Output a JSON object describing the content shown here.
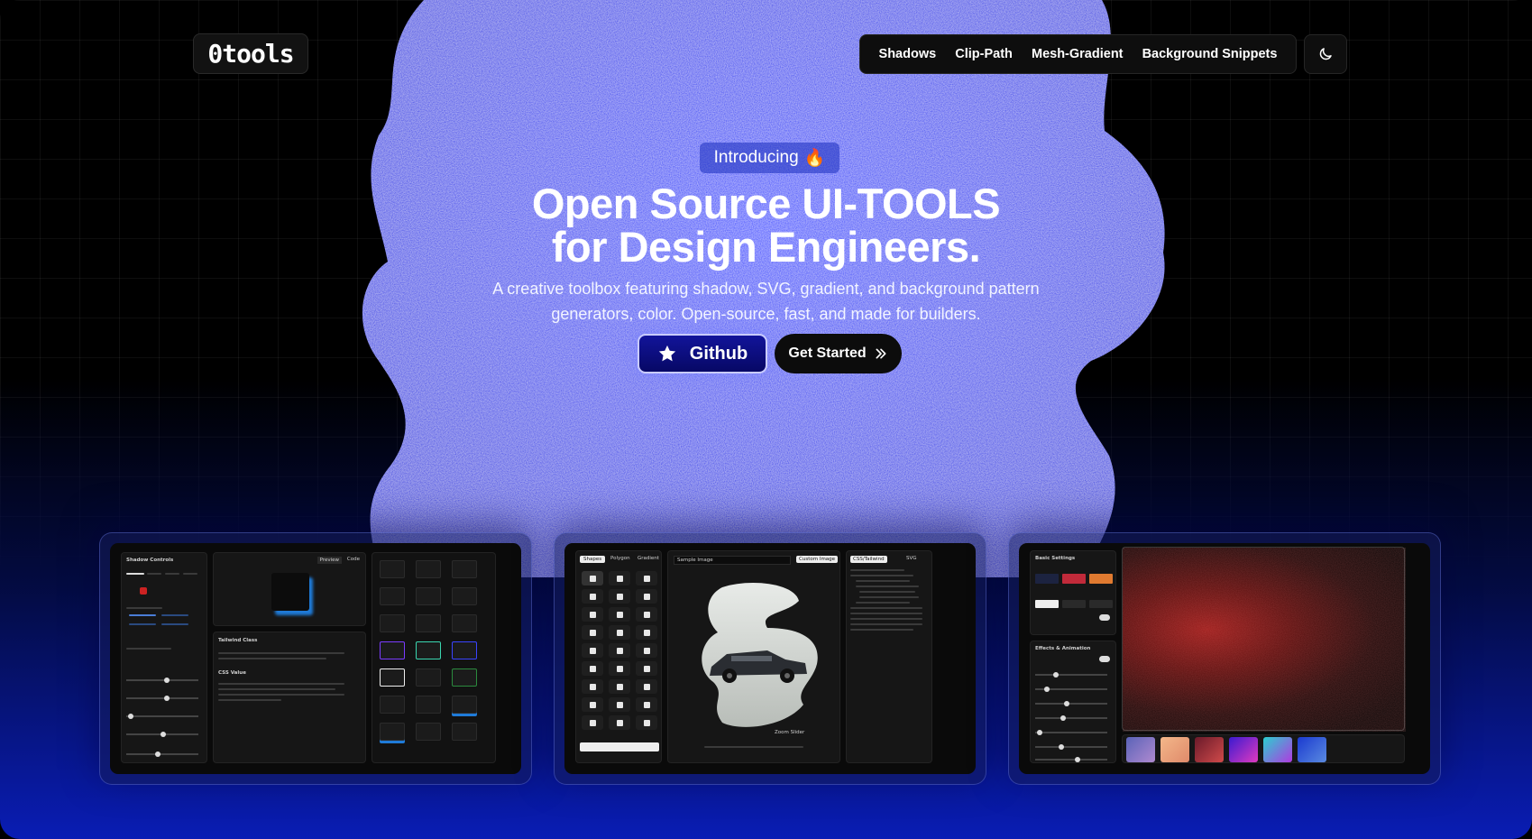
{
  "header": {
    "logo_text": "0tools",
    "nav": [
      "Shadows",
      "Clip-Path",
      "Mesh-Gradient",
      "Background Snippets"
    ],
    "theme_icon": "moon-icon"
  },
  "hero": {
    "badge_text": "Introducing",
    "badge_emoji": "🔥",
    "title_line1": "Open Source UI-TOOLS",
    "title_line2": "for Design Engineers.",
    "subtitle_line1": "A creative toolbox featuring shadow, SVG, gradient, and background pattern",
    "subtitle_line2": "generators, color. Open-source, fast, and made for builders.",
    "github_label": "Github",
    "get_started_label": "Get Started",
    "get_started_icon": "chevrons-right-icon",
    "github_icon": "star-icon"
  },
  "previews": {
    "shadow": {
      "controls_title": "Shadow Controls",
      "tabs": [
        "Preview",
        "Code"
      ],
      "class_title": "Tailwind Class",
      "css_title": "CSS Value"
    },
    "clip": {
      "tabs": [
        "Shapes",
        "Polygon",
        "Gradient"
      ],
      "url_placeholder": "Sample Image",
      "button_label": "Custom Image",
      "code_tabs": [
        "CSS/Tailwind",
        "SVG"
      ],
      "footer": "Zoom Slider"
    },
    "mesh": {
      "basic_title": "Basic Settings",
      "effects_title": "Effects & Animation"
    }
  },
  "colors": {
    "accent": "#1a2dff",
    "background": "#000000"
  }
}
